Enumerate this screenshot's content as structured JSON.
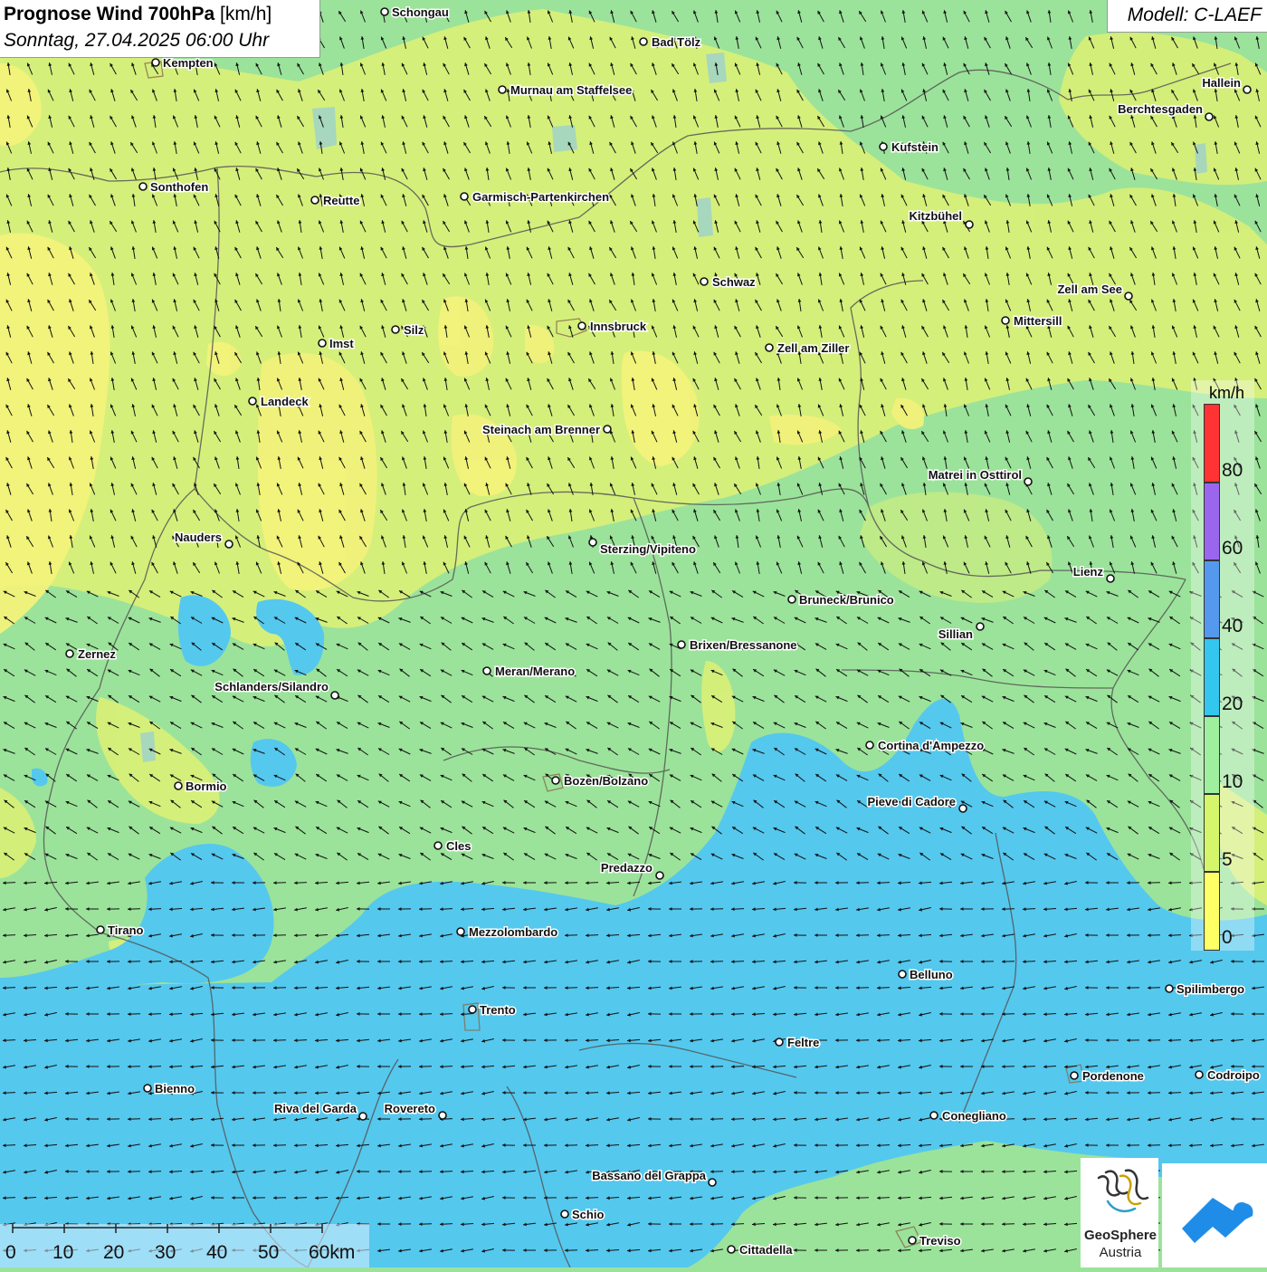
{
  "title": {
    "main": "Prognose Wind 700hPa",
    "unit": "[km/h]",
    "datetime": "Sonntag, 27.04.2025 06:00 Uhr"
  },
  "model": "Modell: C-LAEF",
  "legend": {
    "unit": "km/h",
    "ticks": [
      "80",
      "60",
      "40",
      "20",
      "10",
      "5",
      "0"
    ],
    "colors": [
      "#ff3333",
      "#9b66ee",
      "#5599ee",
      "#33c6ee",
      "#9ef09e",
      "#d5f56b",
      "#ffff66"
    ]
  },
  "scale_bar": {
    "labels": [
      "0",
      "10",
      "20",
      "30",
      "40",
      "50",
      "60km"
    ]
  },
  "logos": {
    "geosphere_line1": "GeoSphere",
    "geosphere_line2": "Austria",
    "geosphere_icon": "geosphere-logo-icon",
    "app_icon": "warnapp-logo-icon"
  },
  "map": {
    "colors": {
      "background": "#9be39a",
      "low_wind": "#d8ef79",
      "very_low_wind": "#f2f27a",
      "moderate_wind": "#55c8ee",
      "borders": "#555555",
      "wind_arrow": "#111111"
    },
    "cities": [
      {
        "name": "Schongau"
      },
      {
        "name": "Bad Tölz"
      },
      {
        "name": "Kempten"
      },
      {
        "name": "Murnau am Staffelsee"
      },
      {
        "name": "Hallein"
      },
      {
        "name": "Berchtesgaden"
      },
      {
        "name": "Kufstein"
      },
      {
        "name": "Sonthofen"
      },
      {
        "name": "Reutte"
      },
      {
        "name": "Garmisch-Partenkirchen"
      },
      {
        "name": "Kitzbühel"
      },
      {
        "name": "Schwaz"
      },
      {
        "name": "Zell am See"
      },
      {
        "name": "Mittersill"
      },
      {
        "name": "Silz"
      },
      {
        "name": "Innsbruck"
      },
      {
        "name": "Imst"
      },
      {
        "name": "Zell am Ziller"
      },
      {
        "name": "Landeck"
      },
      {
        "name": "Steinach am Brenner"
      },
      {
        "name": "Matrei in Osttirol"
      },
      {
        "name": "Nauders"
      },
      {
        "name": "Sterzing/Vipiteno"
      },
      {
        "name": "Lienz"
      },
      {
        "name": "Bruneck/Brunico"
      },
      {
        "name": "Sillian"
      },
      {
        "name": "Zernez"
      },
      {
        "name": "Brixen/Bressanone"
      },
      {
        "name": "Meran/Merano"
      },
      {
        "name": "Schlanders/Silandro"
      },
      {
        "name": "Cortina d'Ampezzo"
      },
      {
        "name": "Bozen/Bolzano"
      },
      {
        "name": "Bormio"
      },
      {
        "name": "Pieve di Cadore"
      },
      {
        "name": "Cles"
      },
      {
        "name": "Predazzo"
      },
      {
        "name": "Tirano"
      },
      {
        "name": "Mezzolombardo"
      },
      {
        "name": "Belluno"
      },
      {
        "name": "Spilimbergo"
      },
      {
        "name": "Trento"
      },
      {
        "name": "Feltre"
      },
      {
        "name": "Pordenone"
      },
      {
        "name": "Codroipo"
      },
      {
        "name": "Bienno"
      },
      {
        "name": "Riva del Garda"
      },
      {
        "name": "Rovereto"
      },
      {
        "name": "Conegliano"
      },
      {
        "name": "Bassano del Grappa"
      },
      {
        "name": "Schio"
      },
      {
        "name": "Treviso"
      },
      {
        "name": "Cittadella"
      }
    ]
  }
}
